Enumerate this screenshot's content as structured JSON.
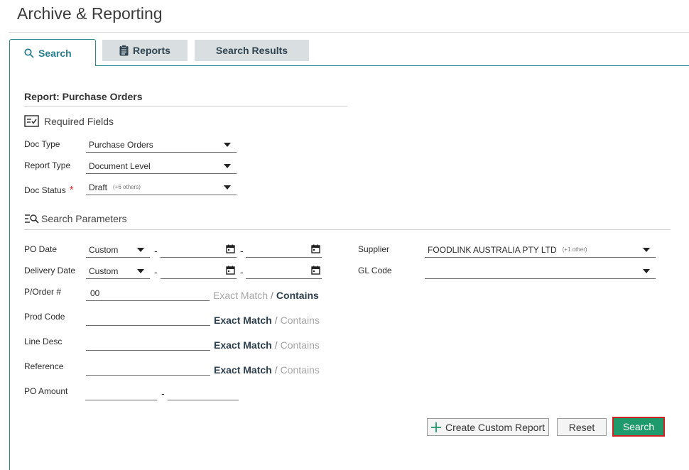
{
  "page": {
    "title": "Archive & Reporting"
  },
  "tabs": {
    "search": "Search",
    "reports": "Reports",
    "results": "Search Results"
  },
  "report_title": "Report: Purchase Orders",
  "required": {
    "heading": "Required Fields",
    "doc_type": {
      "label": "Doc Type",
      "value": "Purchase Orders"
    },
    "report_type": {
      "label": "Report Type",
      "value": "Document Level"
    },
    "doc_status": {
      "label": "Doc Status",
      "required_mark": "*",
      "value": "Draft",
      "others": "(+6 others)"
    }
  },
  "params": {
    "heading": "Search Parameters",
    "po_date": {
      "label": "PO Date",
      "range": "Custom",
      "sep": "-"
    },
    "delivery_date": {
      "label": "Delivery Date",
      "range": "Custom",
      "sep": "-"
    },
    "supplier": {
      "label": "Supplier",
      "value": "FOODLINK AUSTRALIA PTY LTD",
      "others": "(+1 other)"
    },
    "gl_code": {
      "label": "GL Code",
      "value": ""
    },
    "po_number": {
      "label": "P/Order #",
      "value": "00",
      "exact": "Exact Match",
      "sep": "/",
      "contains": "Contains",
      "selected": "contains"
    },
    "prod_code": {
      "label": "Prod Code",
      "value": "",
      "exact": "Exact Match",
      "sep": "/",
      "contains": "Contains",
      "selected": "exact"
    },
    "line_desc": {
      "label": "Line Desc",
      "value": "",
      "exact": "Exact Match",
      "sep": "/",
      "contains": "Contains",
      "selected": "exact"
    },
    "reference": {
      "label": "Reference",
      "value": "",
      "exact": "Exact Match",
      "sep": "/",
      "contains": "Contains",
      "selected": "exact"
    },
    "po_amount": {
      "label": "PO Amount",
      "sep": "-"
    }
  },
  "buttons": {
    "create": "Create Custom Report",
    "reset": "Reset",
    "search": "Search"
  },
  "colors": {
    "accent": "#2e8a8a",
    "search_button": "#1f9a6c",
    "highlight": "#d32020"
  }
}
